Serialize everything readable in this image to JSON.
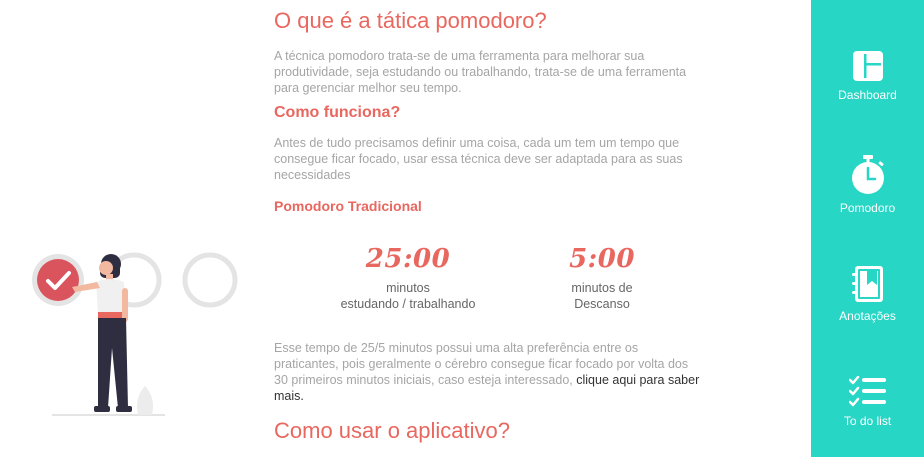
{
  "content": {
    "title": "O que é a tática pomodoro?",
    "intro": "A técnica pomodoro trata-se de uma ferramenta para melhorar sua produtividade, seja estudando ou trabalhando, trata-se de uma ferramenta para gerenciar melhor seu tempo.",
    "how_title": "Como funciona?",
    "how_text": "Antes de tudo precisamos definir uma coisa, cada um tem um tempo que consegue ficar focado, usar essa técnica deve ser adaptada para as suas necessidades",
    "traditional_title": "Pomodoro Tradicional",
    "timers": [
      {
        "value": "25:00",
        "caption_line1": "minutos",
        "caption_line2": "estudando / trabalhando"
      },
      {
        "value": "5:00",
        "caption_line1": "minutos de",
        "caption_line2": "Descanso"
      }
    ],
    "explanation": "Esse tempo de 25/5 minutos possui uma alta preferência entre os praticantes, pois geralmente o cérebro consegue ficar focado por volta dos 30 primeiros minutos iniciais, caso esteja interessado, ",
    "link_text": "clique aqui para saber mais.",
    "usage_title": "Como usar o aplicativo?"
  },
  "sidebar": {
    "items": [
      {
        "label": "Dashboard",
        "icon": "dashboard-icon"
      },
      {
        "label": "Pomodoro",
        "icon": "stopwatch-icon"
      },
      {
        "label": "Anotações",
        "icon": "notebook-icon"
      },
      {
        "label": "To do list",
        "icon": "checklist-icon"
      }
    ]
  },
  "colors": {
    "accent": "#e8675f",
    "sidebar": "#27d6c4",
    "text_muted": "#a5a5a5"
  }
}
